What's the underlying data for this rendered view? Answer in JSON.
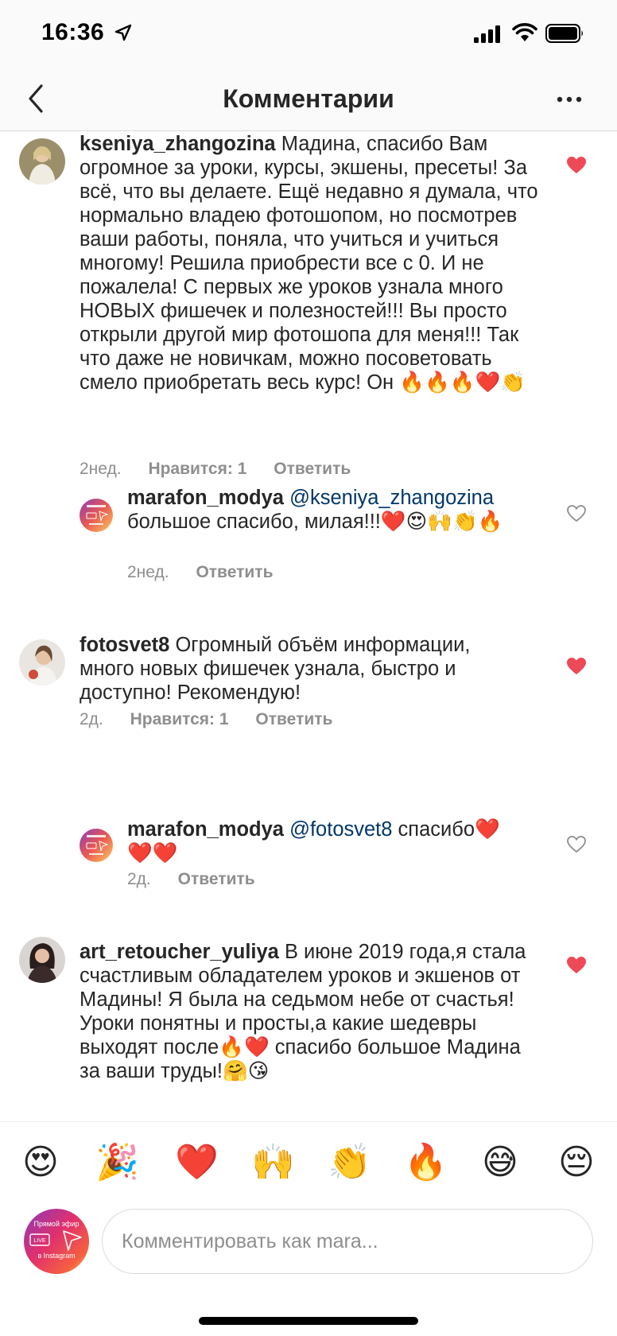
{
  "status": {
    "time": "16:36"
  },
  "nav": {
    "title": "Комментарии"
  },
  "comments": [
    {
      "user": "kseniya_zhangozina",
      "text": "Мадина, спасибо Вам огромное за уроки, курсы, экшены, пресеты! За всё, что вы делаете. Ещё недавно я думала, что нормально владею фотошопом, но посмотрев ваши  работы, поняла, что учиться и учиться многому! Решила приобрести все с 0. И не пожалела! С первых же уроков узнала много НОВЫХ фишечек и полезностей!!! Вы просто открыли другой мир фотошопа для меня!!! Так что даже не новичкам, можно посоветовать смело приобретать весь курс! Он 🔥🔥🔥❤️👏",
      "time": "2нед.",
      "likes": "Нравится: 1",
      "reply": "Ответить",
      "liked": true
    },
    {
      "user": "marafon_modya",
      "mention": "@kseniya_zhangozina",
      "text": " большое спасибо, милая!!!❤️😍🙌👏🔥",
      "time": "2нед.",
      "reply": "Ответить",
      "liked": false
    },
    {
      "user": "fotosvet8",
      "text": "Огромный объём информации, много новых фишечек узнала, быстро и доступно! Рекомендую!",
      "time": "2д.",
      "likes": "Нравится: 1",
      "reply": "Ответить",
      "liked": true
    },
    {
      "user": "marafon_modya",
      "mention": "@fotosvet8",
      "text": " спасибо❤️❤️❤️",
      "time": "2д.",
      "reply": "Ответить",
      "liked": false
    },
    {
      "user": "art_retoucher_yuliya",
      "text": "В июне 2019 года,я стала счастливым обладателем уроков и экшенов от Мадины! Я была на седьмом небе от счастья! Уроки понятны и просты,а какие шедевры выходят после🔥❤️ спасибо большое Мадина за ваши труды!🤗😘",
      "liked": true
    }
  ],
  "live_avatar": {
    "line1": "Прямой эфир",
    "badge": "LIVE",
    "line2": "в Instagram"
  },
  "emoji_bar": [
    "😍",
    "🎉",
    "❤️",
    "🙌",
    "👏",
    "🔥",
    "😅",
    "😔"
  ],
  "composer": {
    "placeholder": "Комментировать как mara..."
  },
  "colors": {
    "heart": "#ed4956",
    "mention": "#00376b",
    "meta": "#8e8e8e"
  }
}
